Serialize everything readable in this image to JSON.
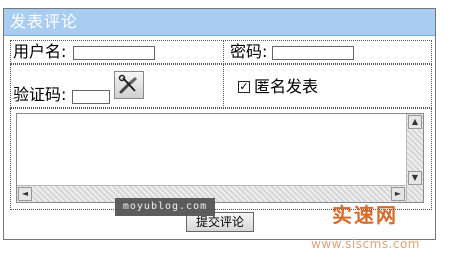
{
  "form": {
    "title": "发表评论",
    "username_label": "用户名:",
    "username_value": "",
    "password_label": "密码:",
    "password_value": "",
    "captcha_label": "验证码:",
    "captcha_value": "",
    "captcha_icon": "tools-icon",
    "anonymous_label": "匿名发表",
    "anonymous_checked": true,
    "anonymous_mark": "✓",
    "comment_value": "",
    "scroll_up": "▲",
    "scroll_down": "▼",
    "scroll_left": "◄",
    "scroll_right": "►",
    "submit_label": "提交评论"
  },
  "watermarks": {
    "overlay_text": "moyublog.com",
    "brand": "实速网",
    "url": "www.siscms.com"
  },
  "colors": {
    "title_bar": "#a9cdf0",
    "brand": "#d46a2b"
  }
}
